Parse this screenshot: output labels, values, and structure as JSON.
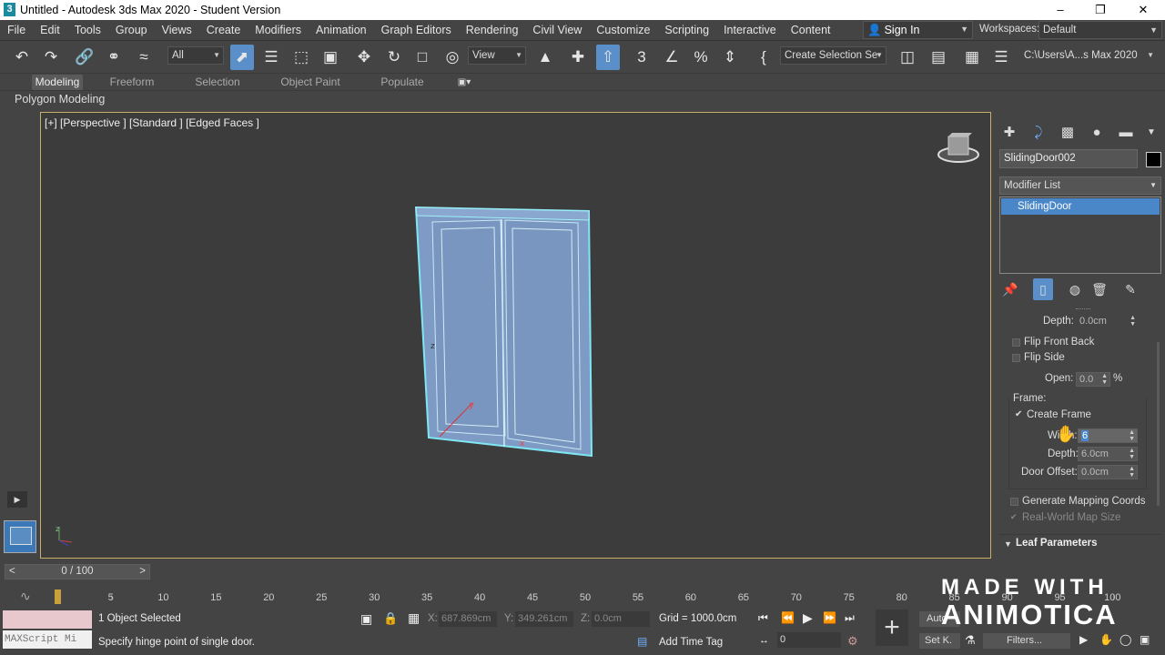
{
  "window": {
    "title": "Untitled - Autodesk 3ds Max 2020 - Student Version",
    "app_icon": "3"
  },
  "menubar": {
    "items": [
      "File",
      "Edit",
      "Tools",
      "Group",
      "Views",
      "Create",
      "Modifiers",
      "Animation",
      "Graph Editors",
      "Rendering",
      "Civil View",
      "Customize",
      "Scripting",
      "Interactive",
      "Content"
    ],
    "signin": "Sign In",
    "workspaces_label": "Workspaces:",
    "workspaces_value": "Default"
  },
  "toolbar": {
    "filter": "All",
    "refcoord": "View",
    "selection_set": "Create Selection Se",
    "project_path": "C:\\Users\\A...s Max 2020"
  },
  "ribbon": {
    "tabs": [
      "Modeling",
      "Freeform",
      "Selection",
      "Object Paint",
      "Populate"
    ],
    "active_tab": "Modeling",
    "panel_label": "Polygon Modeling"
  },
  "viewport": {
    "label": "[+] [Perspective ] [Standard ] [Edged Faces ]"
  },
  "command_panel": {
    "object_name": "SlidingDoor002",
    "modifier_list": "Modifier List",
    "stack_item": "SlidingDoor",
    "params": {
      "depth_top_label": "Depth:",
      "depth_top_value": "0.0cm",
      "flip_front_back": "Flip Front Back",
      "flip_side": "Flip Side",
      "open_label": "Open:",
      "open_value": "0.0",
      "open_unit": "%",
      "frame_label": "Frame:",
      "create_frame": "Create Frame",
      "width_label": "Width:",
      "width_value": "6",
      "depth_label": "Depth:",
      "depth_value": "6.0cm",
      "door_offset_label": "Door Offset:",
      "door_offset_value": "0.0cm",
      "gen_mapping": "Generate Mapping Coords",
      "real_world": "Real-World Map Size",
      "leaf_params": "Leaf Parameters"
    }
  },
  "timeline": {
    "slider": "0 / 100",
    "ticks": [
      "5",
      "10",
      "15",
      "20",
      "25",
      "30",
      "35",
      "40",
      "45",
      "50",
      "55",
      "60",
      "65",
      "70",
      "75",
      "80",
      "85",
      "90",
      "95",
      "100"
    ]
  },
  "status": {
    "maxscript": "MAXScript Mi",
    "selected": "1 Object Selected",
    "prompt": "Specify hinge point of single door.",
    "x_label": "X:",
    "x_value": "687.869cm",
    "y_label": "Y:",
    "y_value": "349.261cm",
    "z_label": "Z:",
    "z_value": "0.0cm",
    "grid": "Grid = 1000.0cm",
    "add_time_tag": "Add Time Tag",
    "frame_value": "0",
    "auto": "Auto",
    "setk": "Set K.",
    "filters": "Filters..."
  },
  "watermark": {
    "line1": "MADE WITH",
    "line2": "ANIMOTICA"
  },
  "colors": {
    "selection": "#5b8fc9",
    "door": "#7d9bc4",
    "door_edge": "#7fe6f2"
  }
}
